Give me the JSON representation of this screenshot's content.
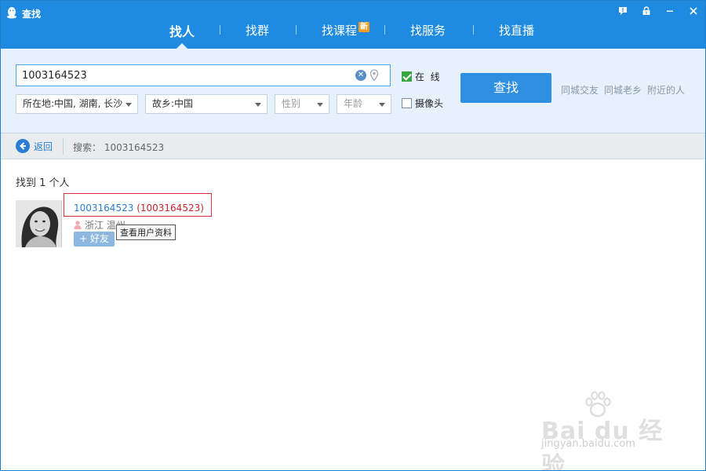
{
  "window": {
    "title": "查找",
    "controls": [
      "feedback-icon",
      "lock-icon",
      "minimize-icon",
      "close-icon"
    ]
  },
  "tabs": [
    {
      "label": "找人",
      "active": true
    },
    {
      "label": "找群",
      "active": false
    },
    {
      "label": "找课程",
      "badge": "新",
      "active": false
    },
    {
      "label": "找服务",
      "active": false
    },
    {
      "label": "找直播",
      "active": false
    }
  ],
  "search": {
    "value": "1003164523",
    "location": "所在地:中国, 湖南, 长沙",
    "hometown": "故乡:中国",
    "gender": "性别",
    "age": "年龄",
    "online_label": "在  线",
    "online_checked": true,
    "camera_label": "摄像头",
    "camera_checked": false,
    "find_button": "查找",
    "quick_links": [
      "同城交友",
      "同城老乡",
      "附近的人"
    ]
  },
  "breadcrumb": {
    "back_label": "返回",
    "search_text": "搜索： 1003164523"
  },
  "results": {
    "count_text": "找到 1 个人",
    "items": [
      {
        "id": "1003164523",
        "nick": "(1003164523)",
        "location": "浙江 温州",
        "add_button": "+ 好友",
        "tooltip": "查看用户资料"
      }
    ]
  },
  "watermark": {
    "text": "Bai du 经验",
    "url": "jingyan.baidu.com"
  },
  "colors": {
    "titlebar": "#1e8be0",
    "panel": "#e7f1fb",
    "accent": "#2f8fe0",
    "link": "#2a7dd0",
    "highlight": "#d9303a",
    "badge": "#f39a1e"
  }
}
